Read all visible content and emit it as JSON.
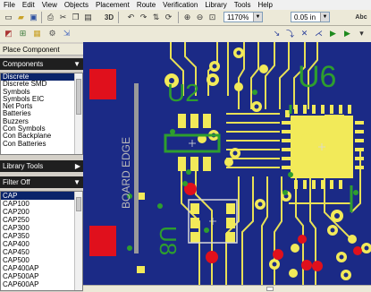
{
  "menu": [
    "File",
    "Edit",
    "View",
    "Objects",
    "Placement",
    "Route",
    "Verification",
    "Library",
    "Tools",
    "Help"
  ],
  "toolbar": {
    "view3d_label": "3D",
    "zoom_value": "1170%",
    "grid_value": "0.05 in"
  },
  "panel": {
    "place_component": "Place Component",
    "components_label": "Components",
    "library_tools_label": "Library Tools",
    "filter_label": "Filter Off",
    "categories": [
      "Discrete",
      "Discrete SMD",
      "Symbols",
      "Symbols EIC",
      "Net Ports",
      "Batteries",
      "Buzzers",
      "Con Symbols",
      "Con Backplane",
      "Con Batteries"
    ],
    "selected_category": "Discrete",
    "parts": [
      "CAP",
      "CAP100",
      "CAP200",
      "CAP250",
      "CAP300",
      "CAP350",
      "CAP400",
      "CAP450",
      "CAP500",
      "CAP400AP",
      "CAP500AP",
      "CAP600AP"
    ],
    "selected_part": "CAP"
  },
  "board": {
    "u2_label": "U2",
    "u6_label": "U6",
    "u8_label": "U8",
    "board_edge_label": "BOARD EDGE",
    "colors": {
      "board": "#1b2a86",
      "copper_top": "#2e9e2e",
      "pad": "#f2ea59",
      "copper_bottom": "#e0101c",
      "silk": "#d9d9d9"
    }
  }
}
